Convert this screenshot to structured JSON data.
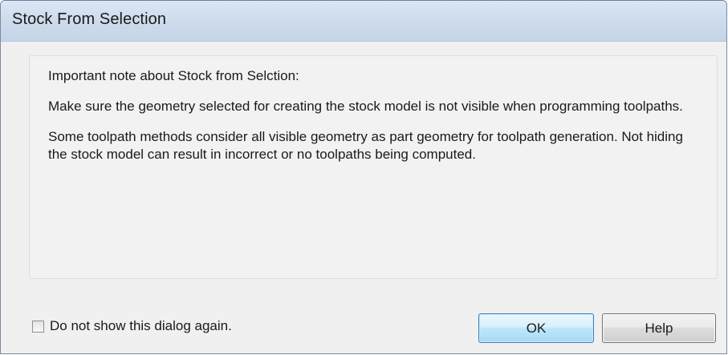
{
  "window": {
    "title": "Stock From Selection"
  },
  "message": {
    "heading": "Important note about Stock from Selction:",
    "paragraph1": "Make sure the geometry selected for creating the stock model is not visible when programming toolpaths.",
    "paragraph2": "Some toolpath methods consider all visible geometry as part geometry for toolpath generation.  Not hiding the stock model can result in incorrect or no toolpaths being computed."
  },
  "footer": {
    "checkbox_label": "Do not show this dialog again.",
    "checkbox_checked": false,
    "ok_label": "OK",
    "help_label": "Help"
  },
  "colors": {
    "titlebar": "#cfdcec",
    "dialog_bg": "#f0f0f0",
    "ok_border": "#3c7fb1"
  }
}
